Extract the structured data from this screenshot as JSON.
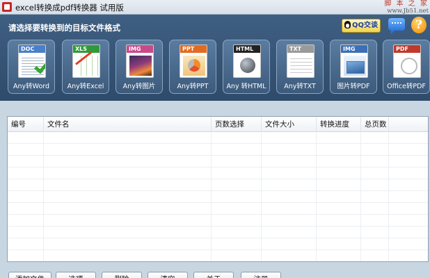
{
  "window": {
    "title": "excel转换成pdf转换器 试用版",
    "watermark_line1": "脚 本 之 家",
    "watermark_line2": "www.Jb51.net"
  },
  "header": {
    "instruction": "请选择要转换到的目标文件格式",
    "qq_label": "QQ交谈",
    "help_symbol": "?"
  },
  "formats": [
    {
      "band": "DOC",
      "band_color": "#4a7fc9",
      "label": "Any转Word",
      "art": "lines"
    },
    {
      "band": "XLS",
      "band_color": "#2f9a3a",
      "label": "Any转Excel",
      "art": "grid"
    },
    {
      "band": "IMG",
      "band_color": "#c94a8a",
      "label": "Any转图片",
      "art": "photo"
    },
    {
      "band": "PPT",
      "band_color": "#e46a1f",
      "label": "Any转PPT",
      "art": "slide"
    },
    {
      "band": "HTML",
      "band_color": "#222222",
      "label": "Any 转HTML",
      "art": "globe"
    },
    {
      "band": "TXT",
      "band_color": "#9a9a9a",
      "label": "Any转TXT",
      "art": "txtlines"
    },
    {
      "band": "IMG",
      "band_color": "#3c6fb8",
      "label": "图片转PDF",
      "art": "img2"
    },
    {
      "band": "PDF",
      "band_color": "#c0392b",
      "label": "Office转PDF",
      "art": "acro"
    }
  ],
  "table": {
    "columns": [
      "编号",
      "文件名",
      "页数选择",
      "文件大小",
      "转换进度",
      "总页数"
    ],
    "rows": []
  },
  "buttons": [
    "添加文件",
    "选项",
    "删除",
    "清空",
    "关于",
    "注册"
  ]
}
